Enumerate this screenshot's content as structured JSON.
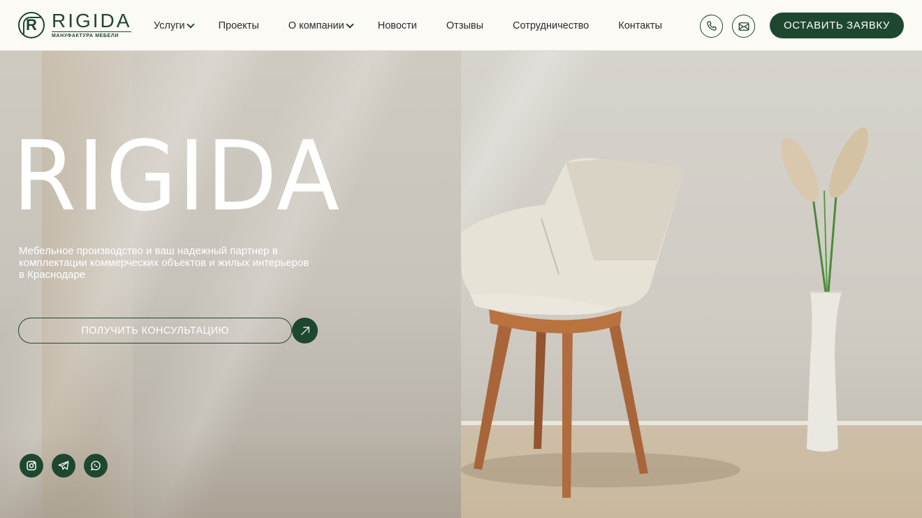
{
  "brand": {
    "name": "RIGIDA",
    "tagline": "МАНУФАКТУРА МЕБЕЛИ",
    "accent": "#1e4730"
  },
  "nav": [
    {
      "label": "Услуги",
      "dropdown": true
    },
    {
      "label": "Проекты",
      "dropdown": false
    },
    {
      "label": "О компании",
      "dropdown": true
    },
    {
      "label": "Новости",
      "dropdown": false
    },
    {
      "label": "Отзывы",
      "dropdown": false
    },
    {
      "label": "Сотрудничество",
      "dropdown": false
    },
    {
      "label": "Контакты",
      "dropdown": false
    }
  ],
  "header_icons": [
    "phone-icon",
    "mail-icon"
  ],
  "cta_label": "ОСТАВИТЬ ЗАЯВКУ",
  "hero": {
    "title": "RIGIDA",
    "subtitle": "Мебельное производство и ваш надежный партнер в комплектации коммерческих объектов и жилых интерьеров в Краснодаре",
    "consult_label": "ПОЛУЧИТЬ КОНСУЛЬТАЦИЮ"
  },
  "social": [
    "instagram-icon",
    "telegram-icon",
    "whatsapp-icon"
  ]
}
